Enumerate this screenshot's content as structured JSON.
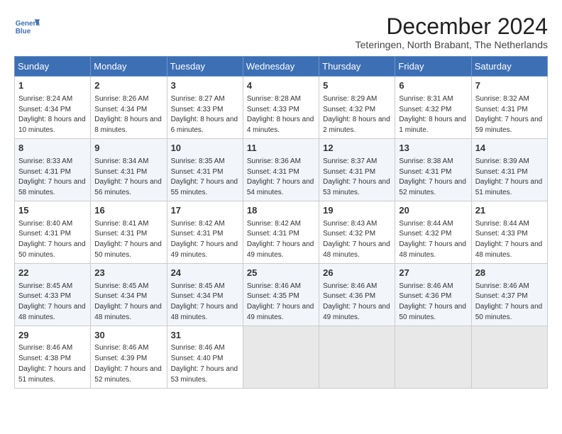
{
  "header": {
    "logo_line1": "General",
    "logo_line2": "Blue",
    "month_year": "December 2024",
    "location": "Teteringen, North Brabant, The Netherlands"
  },
  "days_of_week": [
    "Sunday",
    "Monday",
    "Tuesday",
    "Wednesday",
    "Thursday",
    "Friday",
    "Saturday"
  ],
  "weeks": [
    [
      {
        "day": "1",
        "sunrise": "8:24 AM",
        "sunset": "4:34 PM",
        "daylight": "8 hours and 10 minutes."
      },
      {
        "day": "2",
        "sunrise": "8:26 AM",
        "sunset": "4:34 PM",
        "daylight": "8 hours and 8 minutes."
      },
      {
        "day": "3",
        "sunrise": "8:27 AM",
        "sunset": "4:33 PM",
        "daylight": "8 hours and 6 minutes."
      },
      {
        "day": "4",
        "sunrise": "8:28 AM",
        "sunset": "4:33 PM",
        "daylight": "8 hours and 4 minutes."
      },
      {
        "day": "5",
        "sunrise": "8:29 AM",
        "sunset": "4:32 PM",
        "daylight": "8 hours and 2 minutes."
      },
      {
        "day": "6",
        "sunrise": "8:31 AM",
        "sunset": "4:32 PM",
        "daylight": "8 hours and 1 minute."
      },
      {
        "day": "7",
        "sunrise": "8:32 AM",
        "sunset": "4:31 PM",
        "daylight": "7 hours and 59 minutes."
      }
    ],
    [
      {
        "day": "8",
        "sunrise": "8:33 AM",
        "sunset": "4:31 PM",
        "daylight": "7 hours and 58 minutes."
      },
      {
        "day": "9",
        "sunrise": "8:34 AM",
        "sunset": "4:31 PM",
        "daylight": "7 hours and 56 minutes."
      },
      {
        "day": "10",
        "sunrise": "8:35 AM",
        "sunset": "4:31 PM",
        "daylight": "7 hours and 55 minutes."
      },
      {
        "day": "11",
        "sunrise": "8:36 AM",
        "sunset": "4:31 PM",
        "daylight": "7 hours and 54 minutes."
      },
      {
        "day": "12",
        "sunrise": "8:37 AM",
        "sunset": "4:31 PM",
        "daylight": "7 hours and 53 minutes."
      },
      {
        "day": "13",
        "sunrise": "8:38 AM",
        "sunset": "4:31 PM",
        "daylight": "7 hours and 52 minutes."
      },
      {
        "day": "14",
        "sunrise": "8:39 AM",
        "sunset": "4:31 PM",
        "daylight": "7 hours and 51 minutes."
      }
    ],
    [
      {
        "day": "15",
        "sunrise": "8:40 AM",
        "sunset": "4:31 PM",
        "daylight": "7 hours and 50 minutes."
      },
      {
        "day": "16",
        "sunrise": "8:41 AM",
        "sunset": "4:31 PM",
        "daylight": "7 hours and 50 minutes."
      },
      {
        "day": "17",
        "sunrise": "8:42 AM",
        "sunset": "4:31 PM",
        "daylight": "7 hours and 49 minutes."
      },
      {
        "day": "18",
        "sunrise": "8:42 AM",
        "sunset": "4:31 PM",
        "daylight": "7 hours and 49 minutes."
      },
      {
        "day": "19",
        "sunrise": "8:43 AM",
        "sunset": "4:32 PM",
        "daylight": "7 hours and 48 minutes."
      },
      {
        "day": "20",
        "sunrise": "8:44 AM",
        "sunset": "4:32 PM",
        "daylight": "7 hours and 48 minutes."
      },
      {
        "day": "21",
        "sunrise": "8:44 AM",
        "sunset": "4:33 PM",
        "daylight": "7 hours and 48 minutes."
      }
    ],
    [
      {
        "day": "22",
        "sunrise": "8:45 AM",
        "sunset": "4:33 PM",
        "daylight": "7 hours and 48 minutes."
      },
      {
        "day": "23",
        "sunrise": "8:45 AM",
        "sunset": "4:34 PM",
        "daylight": "7 hours and 48 minutes."
      },
      {
        "day": "24",
        "sunrise": "8:45 AM",
        "sunset": "4:34 PM",
        "daylight": "7 hours and 48 minutes."
      },
      {
        "day": "25",
        "sunrise": "8:46 AM",
        "sunset": "4:35 PM",
        "daylight": "7 hours and 49 minutes."
      },
      {
        "day": "26",
        "sunrise": "8:46 AM",
        "sunset": "4:36 PM",
        "daylight": "7 hours and 49 minutes."
      },
      {
        "day": "27",
        "sunrise": "8:46 AM",
        "sunset": "4:36 PM",
        "daylight": "7 hours and 50 minutes."
      },
      {
        "day": "28",
        "sunrise": "8:46 AM",
        "sunset": "4:37 PM",
        "daylight": "7 hours and 50 minutes."
      }
    ],
    [
      {
        "day": "29",
        "sunrise": "8:46 AM",
        "sunset": "4:38 PM",
        "daylight": "7 hours and 51 minutes."
      },
      {
        "day": "30",
        "sunrise": "8:46 AM",
        "sunset": "4:39 PM",
        "daylight": "7 hours and 52 minutes."
      },
      {
        "day": "31",
        "sunrise": "8:46 AM",
        "sunset": "4:40 PM",
        "daylight": "7 hours and 53 minutes."
      },
      null,
      null,
      null,
      null
    ]
  ]
}
